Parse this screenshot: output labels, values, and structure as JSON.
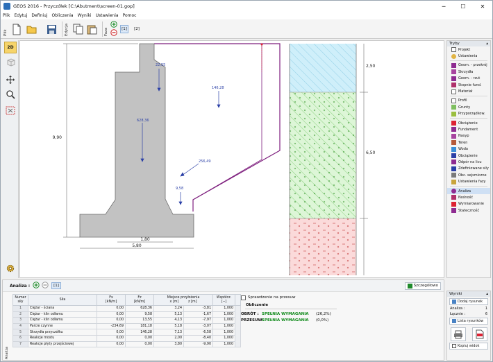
{
  "window": {
    "title": "GEOS 2016 - Przyczółek [C:\\Abutment\\screen-01.gop]",
    "min": "─",
    "max": "☐",
    "close": "✕"
  },
  "menu": [
    "Plik",
    "Edytuj",
    "Definiuj",
    "Obliczenia",
    "Wyniki",
    "Ustawienia",
    "Pomoc"
  ],
  "toolbar": {
    "label_plik": "Plik",
    "label_edycja": "Edycja",
    "label_faza": "Faza",
    "stage1": "[1]",
    "stage2": "[2]"
  },
  "lefttools": {
    "mode2d": "2D"
  },
  "drawing": {
    "dim_heights": [
      "9,90",
      "2,50",
      "6,50"
    ],
    "dim_widths": [
      "1,80",
      "5,80"
    ],
    "forces": [
      "22,55",
      "146,28",
      "628,36",
      "256,49",
      "9,58"
    ]
  },
  "rightpanel": {
    "title": "Tryby",
    "pin": "▴",
    "items": [
      "Projekt",
      "Ustawienia",
      "Geom. - przekrój",
      "Skrzydła",
      "Geom. - rzut",
      "Stopnie fund.",
      "Materiał",
      "Profil",
      "Grunty",
      "Przyporządkow.",
      "Obciążenie",
      "Fundament",
      "Nasyp",
      "Teren",
      "Woda",
      "Obciążenie",
      "Odpór na licu",
      "Zdefiniowane siły",
      "Obc. sejsmiczne",
      "Ustawienia fazy",
      "Analiza",
      "Nośność",
      "Wymiarowanie",
      "Stateczność"
    ]
  },
  "bottom": {
    "side_label": "Analiza",
    "title": "Analiza :",
    "tab": "[1]",
    "details_btn": "Szczegółowo",
    "headers": [
      "Numer siły",
      "Siła",
      "Fx [kN/m]",
      "Fz [kN/m]",
      "Miejsce przyłożenia x [m]",
      "z [m]",
      "Współcz. [--]"
    ],
    "header_parts": {
      "num": "Numer",
      "sil": "siły",
      "sila": "Siła",
      "fx": "Fx",
      "fz": "Fz",
      "unit": "[kN/m]",
      "place": "Miejsce przyłożenia",
      "x": "x [m]",
      "z": "z [m]",
      "coef": "Współcz.",
      "coefu": "[--]"
    },
    "rows": [
      [
        "1",
        "Ciężar - ściana",
        "0,00",
        "628,36",
        "3,24",
        "-3,81",
        "1,000"
      ],
      [
        "2",
        "Ciężar - klin odłamu",
        "0,00",
        "9,58",
        "5,13",
        "-1,67",
        "1,000"
      ],
      [
        "3",
        "Ciężar - klin odłamu",
        "0,00",
        "13,55",
        "4,13",
        "-7,97",
        "1,000"
      ],
      [
        "4",
        "Parcie czynne",
        "-234,69",
        "181,18",
        "5,18",
        "-3,07",
        "1,000"
      ],
      [
        "5",
        "Skrzydła przyczółku",
        "0,00",
        "146,28",
        "7,13",
        "-6,58",
        "1,000"
      ],
      [
        "6",
        "Reakcje mostu",
        "0,00",
        "0,00",
        "2,00",
        "-8,40",
        "1,000"
      ],
      [
        "7",
        "Reakcje płyty przejściowej",
        "0,00",
        "0,00",
        "3,80",
        "-9,90",
        "1,000"
      ]
    ],
    "check_label": "Sprawdzenie na przesuw",
    "calc_title": "Obliczenie",
    "results": [
      {
        "k": "OBRÓT :",
        "v": "SPEŁNIA WYMAGANIA",
        "p": "(26,2%)"
      },
      {
        "k": "PRZESUW:",
        "v": "SPEŁNIA WYMAGANIA",
        "p": "(0,0%)"
      }
    ]
  },
  "outputs": {
    "title": "Wyniki",
    "pin": "▴",
    "add_btn": "Dodaj rysunek",
    "analiza_label": "Analiza :",
    "analiza_count": "1",
    "total_label": "Łącznie :",
    "total_count": "6",
    "list_btn": "Lista rysunków",
    "copy_btn": "Kopiuj widok"
  }
}
